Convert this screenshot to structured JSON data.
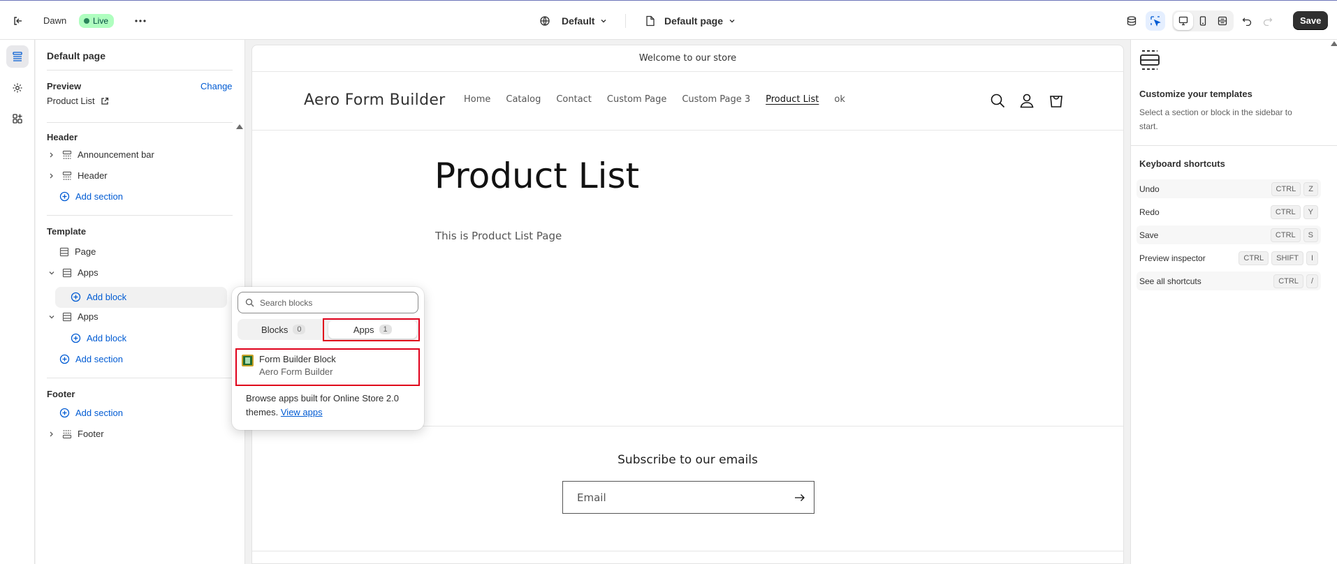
{
  "topbar": {
    "theme_name": "Dawn",
    "live_label": "Live",
    "theme_select": "Default",
    "page_select": "Default page",
    "save_label": "Save"
  },
  "sidebar": {
    "title": "Default page",
    "preview_label": "Preview",
    "change_label": "Change",
    "preview_page": "Product List",
    "header_group": "Header",
    "header_items": [
      "Announcement bar",
      "Header"
    ],
    "add_section": "Add section",
    "template_group": "Template",
    "template_items": [
      "Page",
      "Apps",
      "Apps"
    ],
    "add_block": "Add block",
    "footer_group": "Footer",
    "footer_item": "Footer"
  },
  "store": {
    "announcement": "Welcome to our store",
    "logo": "Aero Form Builder",
    "nav": [
      "Home",
      "Catalog",
      "Contact",
      "Custom Page",
      "Custom Page 3",
      "Product List",
      "ok"
    ],
    "page_title": "Product List",
    "page_body": "This is Product List Page",
    "subscribe_title": "Subscribe to our emails",
    "email_placeholder": "Email"
  },
  "popover": {
    "search_placeholder": "Search blocks",
    "tabs": [
      {
        "label": "Blocks",
        "count": "0"
      },
      {
        "label": "Apps",
        "count": "1"
      }
    ],
    "app_block_title": "Form Builder Block",
    "app_block_subtitle": "Aero Form Builder",
    "browse_text": "Browse apps built for Online Store 2.0 themes.",
    "view_apps": "View apps"
  },
  "right_panel": {
    "title": "Customize your templates",
    "text": "Select a section or block in the sidebar to start.",
    "shortcuts_title": "Keyboard shortcuts",
    "shortcuts": [
      {
        "label": "Undo",
        "keys": [
          "CTRL",
          "Z"
        ]
      },
      {
        "label": "Redo",
        "keys": [
          "CTRL",
          "Y"
        ]
      },
      {
        "label": "Save",
        "keys": [
          "CTRL",
          "S"
        ]
      },
      {
        "label": "Preview inspector",
        "keys": [
          "CTRL",
          "SHIFT",
          "I"
        ]
      },
      {
        "label": "See all shortcuts",
        "keys": [
          "CTRL",
          "/"
        ]
      }
    ]
  },
  "colors": {
    "accent_link": "#005bd3",
    "highlight_red": "#e0001b",
    "live_badge_bg": "#affebf",
    "save_button_bg": "#303030"
  }
}
